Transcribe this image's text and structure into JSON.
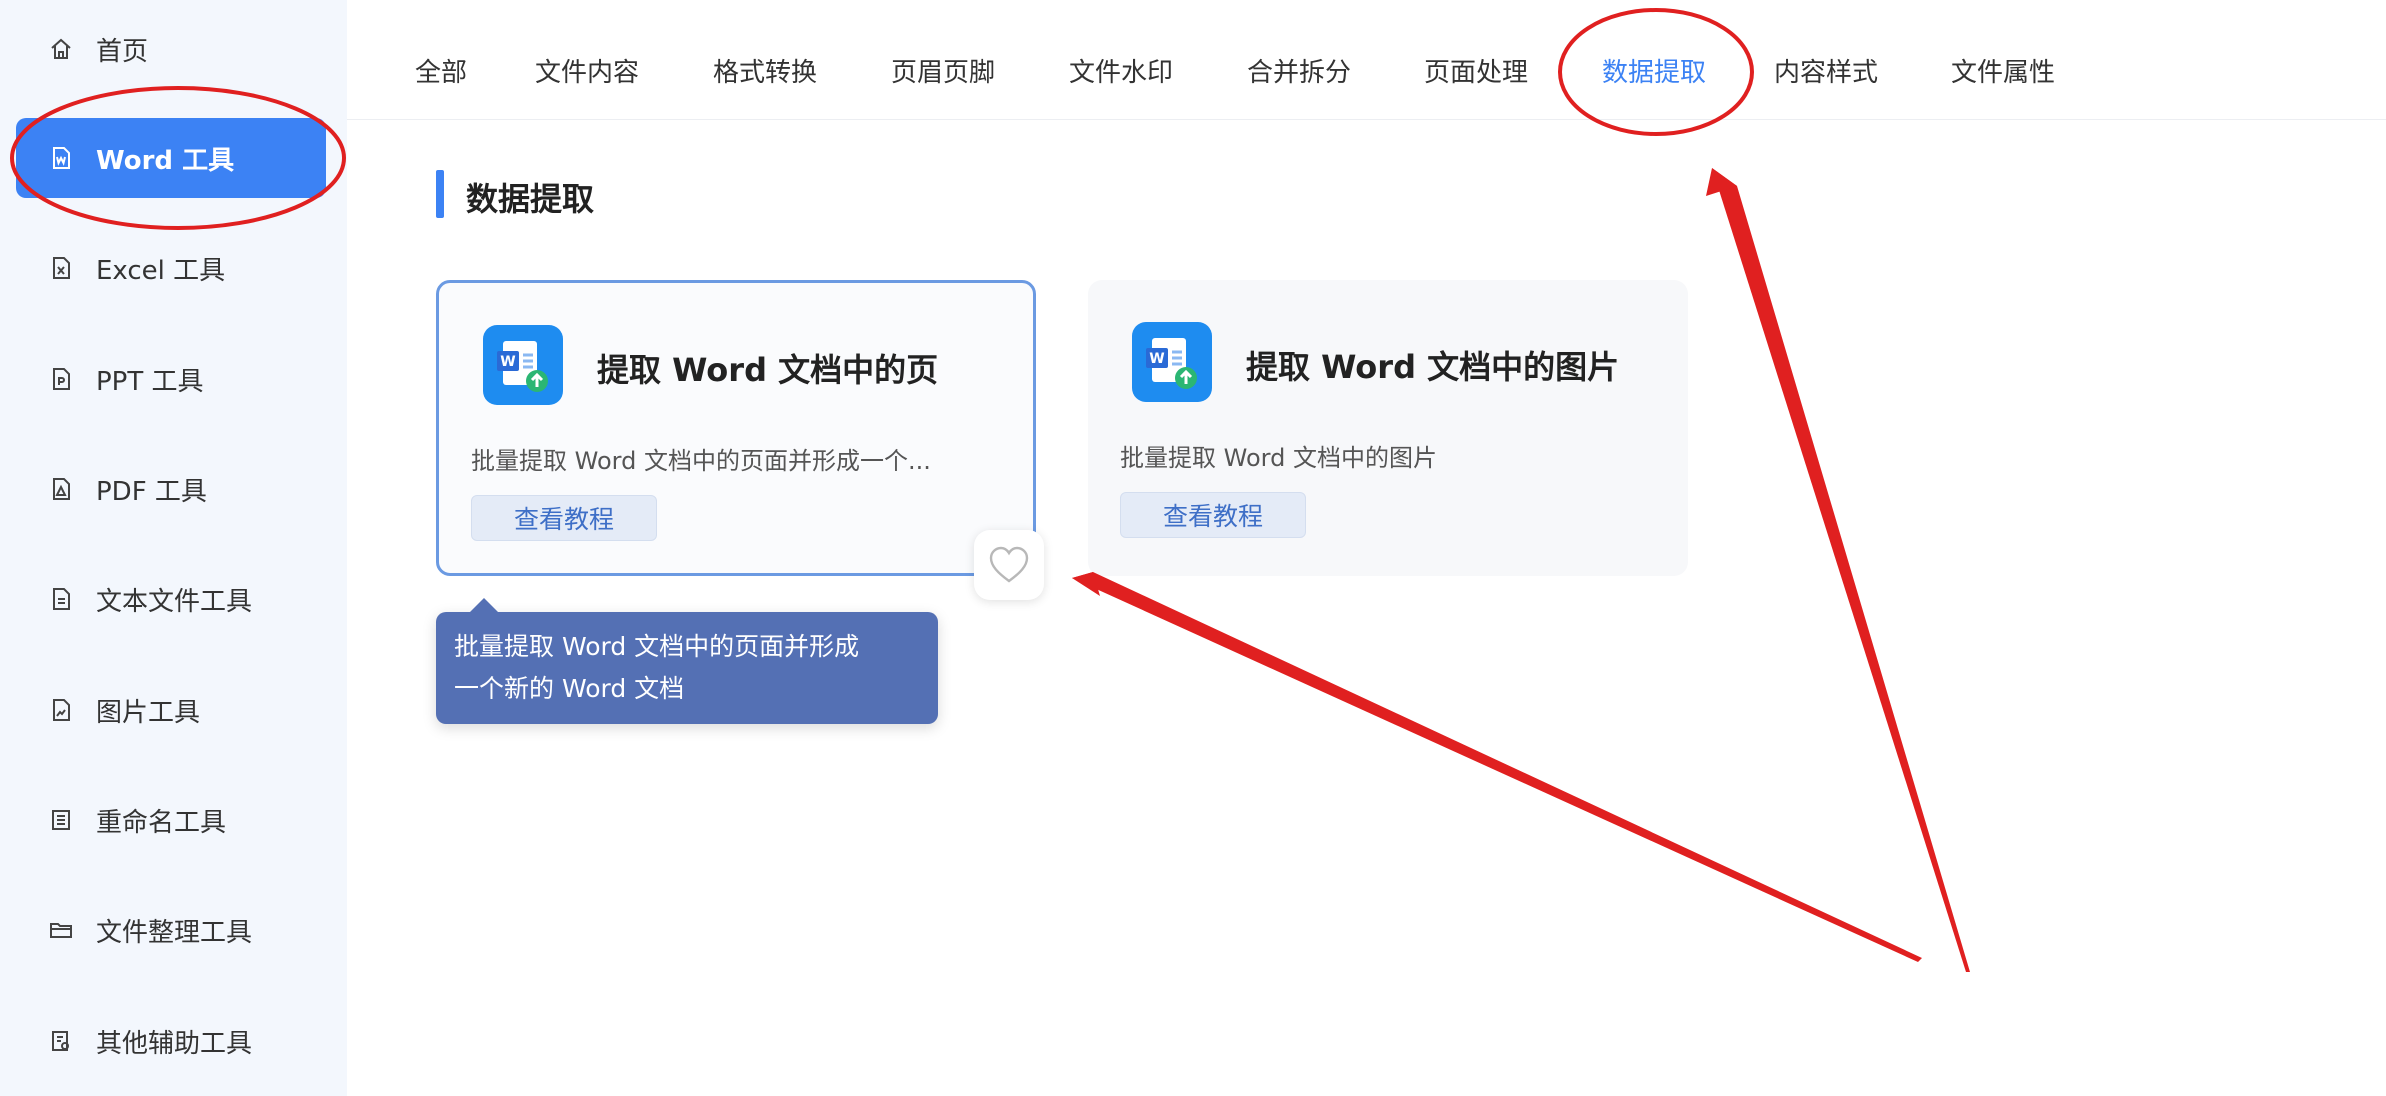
{
  "sidebar": {
    "items": [
      {
        "label": "首页",
        "icon": "home-icon"
      },
      {
        "label": "Word 工具",
        "icon": "word-file-icon",
        "active": true
      },
      {
        "label": "Excel 工具",
        "icon": "excel-file-icon"
      },
      {
        "label": "PPT 工具",
        "icon": "ppt-file-icon"
      },
      {
        "label": "PDF 工具",
        "icon": "pdf-file-icon"
      },
      {
        "label": "文本文件工具",
        "icon": "text-file-icon"
      },
      {
        "label": "图片工具",
        "icon": "image-file-icon"
      },
      {
        "label": "重命名工具",
        "icon": "rename-icon"
      },
      {
        "label": "文件整理工具",
        "icon": "folder-icon"
      },
      {
        "label": "其他辅助工具",
        "icon": "tools-icon"
      }
    ]
  },
  "tabs": [
    {
      "label": "全部"
    },
    {
      "label": "文件内容"
    },
    {
      "label": "格式转换"
    },
    {
      "label": "页眉页脚"
    },
    {
      "label": "文件水印"
    },
    {
      "label": "合并拆分"
    },
    {
      "label": "页面处理"
    },
    {
      "label": "数据提取",
      "active": true
    },
    {
      "label": "内容样式"
    },
    {
      "label": "文件属性"
    }
  ],
  "section": {
    "title": "数据提取"
  },
  "cards": [
    {
      "title": "提取 Word 文档中的页",
      "desc": "批量提取 Word 文档中的页面并形成一个...",
      "button": "查看教程"
    },
    {
      "title": "提取 Word 文档中的图片",
      "desc": "批量提取 Word 文档中的图片",
      "button": "查看教程"
    }
  ],
  "tooltip": {
    "line1": "批量提取 Word 文档中的页面并形成",
    "line2": "一个新的 Word 文档"
  },
  "colors": {
    "accent": "#3c82f4",
    "annotation": "#e02020",
    "tooltip_bg": "#5470b4"
  }
}
